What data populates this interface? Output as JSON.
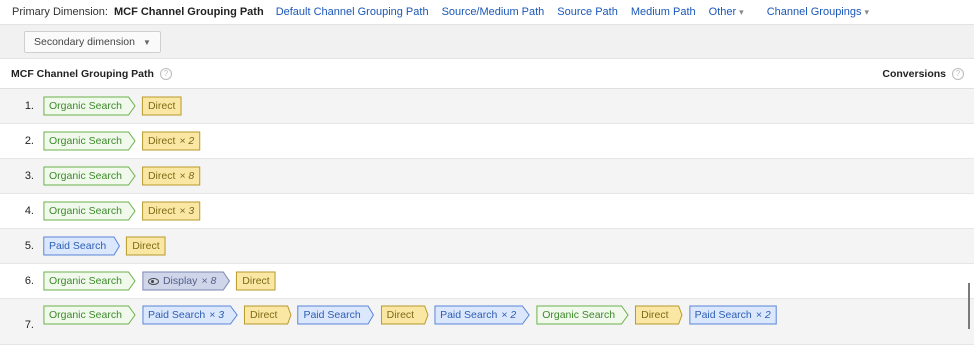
{
  "dimension_bar": {
    "label": "Primary Dimension:",
    "selected": "MCF Channel Grouping Path",
    "options": [
      "Default Channel Grouping Path",
      "Source/Medium Path",
      "Source Path",
      "Medium Path"
    ],
    "other": "Other",
    "channel_groupings": "Channel Groupings"
  },
  "secondary_dimension": {
    "label": "Secondary dimension"
  },
  "table": {
    "column_path": "MCF Channel Grouping Path",
    "column_conversions": "Conversions",
    "help": "?"
  },
  "colors": {
    "organic": {
      "fill": "#f1f9ec",
      "stroke": "#6cb14a"
    },
    "direct": {
      "fill": "#fbe7a4",
      "stroke": "#b79a2c"
    },
    "paid": {
      "fill": "#dbe7fc",
      "stroke": "#5a86d6"
    },
    "display": {
      "fill": "#cfd6ea",
      "stroke": "#7c86b1"
    },
    "link": "#1a57b8"
  },
  "rows": [
    {
      "num": "1.",
      "steps": [
        {
          "type": "organic",
          "label": "Organic Search",
          "mult": ""
        },
        {
          "type": "direct",
          "label": "Direct",
          "mult": ""
        }
      ]
    },
    {
      "num": "2.",
      "steps": [
        {
          "type": "organic",
          "label": "Organic Search",
          "mult": ""
        },
        {
          "type": "direct",
          "label": "Direct",
          "mult": "× 2"
        }
      ]
    },
    {
      "num": "3.",
      "steps": [
        {
          "type": "organic",
          "label": "Organic Search",
          "mult": ""
        },
        {
          "type": "direct",
          "label": "Direct",
          "mult": "× 8"
        }
      ]
    },
    {
      "num": "4.",
      "steps": [
        {
          "type": "organic",
          "label": "Organic Search",
          "mult": ""
        },
        {
          "type": "direct",
          "label": "Direct",
          "mult": "× 3"
        }
      ]
    },
    {
      "num": "5.",
      "steps": [
        {
          "type": "paid",
          "label": "Paid Search",
          "mult": ""
        },
        {
          "type": "direct",
          "label": "Direct",
          "mult": ""
        }
      ]
    },
    {
      "num": "6.",
      "steps": [
        {
          "type": "organic",
          "label": "Organic Search",
          "mult": ""
        },
        {
          "type": "display",
          "label": "Display",
          "mult": "× 8",
          "icon": "eye-icon"
        },
        {
          "type": "direct",
          "label": "Direct",
          "mult": ""
        }
      ]
    },
    {
      "num": "7.",
      "steps": [
        {
          "type": "organic",
          "label": "Organic Search",
          "mult": ""
        },
        {
          "type": "paid",
          "label": "Paid Search",
          "mult": "× 3"
        },
        {
          "type": "direct",
          "label": "Direct",
          "mult": ""
        },
        {
          "type": "paid",
          "label": "Paid Search",
          "mult": ""
        },
        {
          "type": "direct",
          "label": "Direct",
          "mult": ""
        },
        {
          "type": "paid",
          "label": "Paid Search",
          "mult": "× 2"
        },
        {
          "type": "organic",
          "label": "Organic Search",
          "mult": ""
        },
        {
          "type": "direct",
          "label": "Direct",
          "mult": ""
        },
        {
          "type": "paid",
          "label": "Paid Search",
          "mult": "× 2"
        }
      ]
    }
  ]
}
